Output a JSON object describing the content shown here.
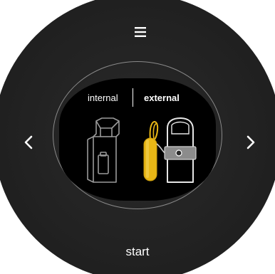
{
  "menu": {
    "icon": "hamburger-menu-icon"
  },
  "navigation": {
    "prev_icon": "chevron-left-icon",
    "next_icon": "chevron-right-icon"
  },
  "sensor_toggle": {
    "options": [
      "internal",
      "external"
    ],
    "selected": "external"
  },
  "illustrations": {
    "internal": "internal-sensor-device-icon",
    "external": "external-sensor-probe-icon"
  },
  "actions": {
    "start_label": "start"
  },
  "colors": {
    "dial": "#222222",
    "screen": "#000000",
    "accent_probe": "#e8b716",
    "text": "#ffffff"
  }
}
